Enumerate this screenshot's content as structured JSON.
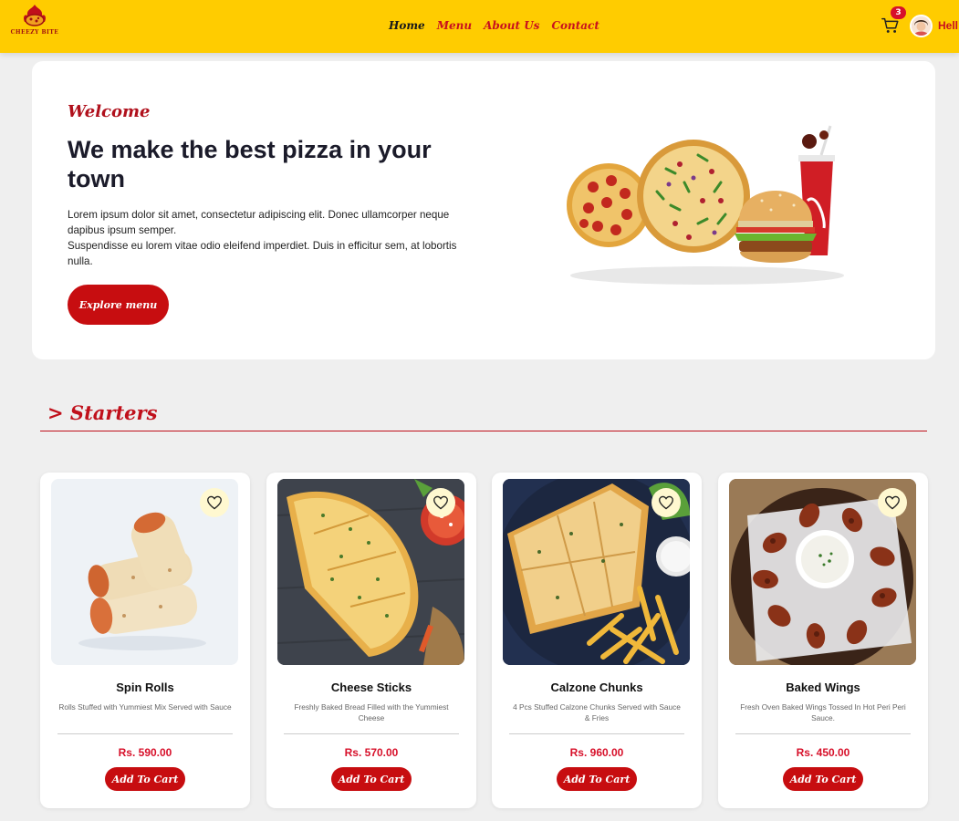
{
  "brand": {
    "logo_text": "CHEEZY BITE"
  },
  "nav": {
    "home": "Home",
    "menu": "Menu",
    "about": "About Us",
    "contact": "Contact"
  },
  "cart": {
    "count": "3"
  },
  "user": {
    "greeting": "Hell"
  },
  "hero": {
    "welcome": "Welcome",
    "headline": "We make the best pizza in your town",
    "body_line1": "Lorem ipsum dolor sit amet, consectetur adipiscing elit. Donec ullamcorper neque dapibus ipsum semper.",
    "body_line2": "Suspendisse eu lorem vitae odio eleifend imperdiet. Duis in efficitur sem, at lobortis nulla.",
    "cta": "Explore menu"
  },
  "section": {
    "title": "> Starters"
  },
  "products": [
    {
      "name": "Spin Rolls",
      "desc": "Rolls Stuffed with Yummiest Mix Served with Sauce",
      "price": "Rs. 590.00",
      "cta": "Add To Cart"
    },
    {
      "name": "Cheese Sticks",
      "desc": "Freshly Baked Bread Filled with the Yummiest Cheese",
      "price": "Rs. 570.00",
      "cta": "Add To Cart"
    },
    {
      "name": "Calzone Chunks",
      "desc": "4 Pcs Stuffed Calzone Chunks Served with Sauce & Fries",
      "price": "Rs. 960.00",
      "cta": "Add To Cart"
    },
    {
      "name": "Baked Wings",
      "desc": "Fresh Oven Baked Wings Tossed In Hot Peri Peri Sauce.",
      "price": "Rs. 450.00",
      "cta": "Add To Cart"
    }
  ],
  "colors": {
    "header": "#ffcc00",
    "brand_red": "#c70d10",
    "price_red": "#d7102a"
  }
}
